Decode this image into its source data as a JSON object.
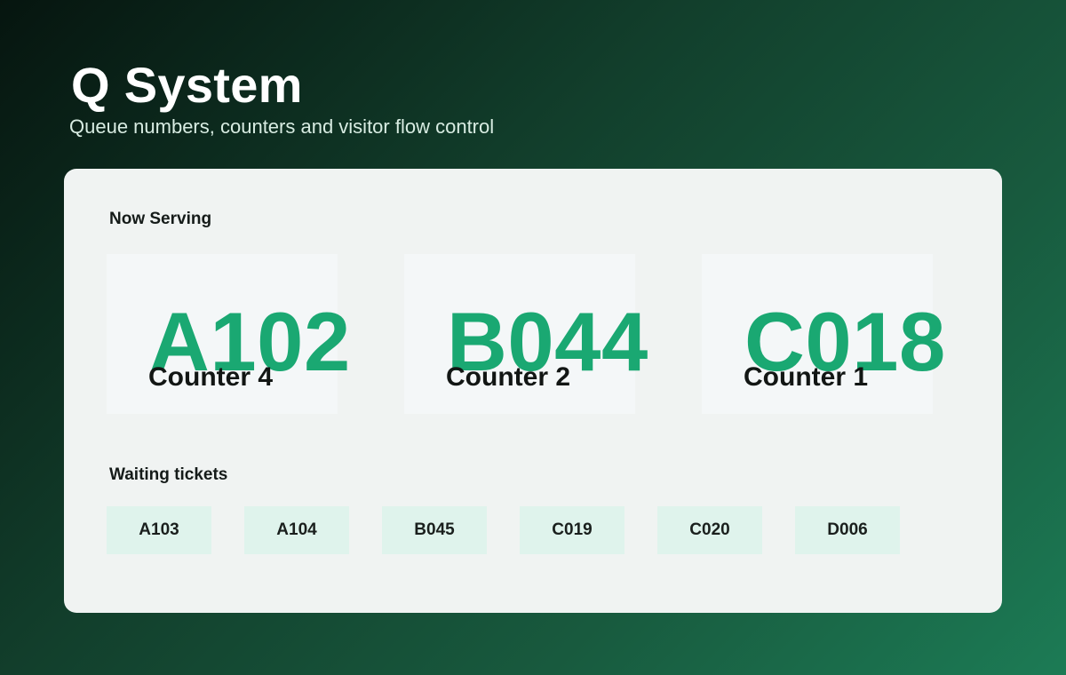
{
  "header": {
    "title": "Q System",
    "subtitle": "Queue numbers, counters and visitor flow control"
  },
  "now_serving": {
    "label": "Now Serving",
    "counters": [
      {
        "ticket": "A102",
        "counter": "Counter 4"
      },
      {
        "ticket": "B044",
        "counter": "Counter 2"
      },
      {
        "ticket": "C018",
        "counter": "Counter 1"
      }
    ]
  },
  "waiting": {
    "label": "Waiting tickets",
    "tickets": [
      "A103",
      "A104",
      "B045",
      "C019",
      "C020",
      "D006"
    ]
  },
  "colors": {
    "accent": "#1aa872",
    "chip_background": "#dff3ec",
    "panel_background": "#f0f3f2"
  }
}
